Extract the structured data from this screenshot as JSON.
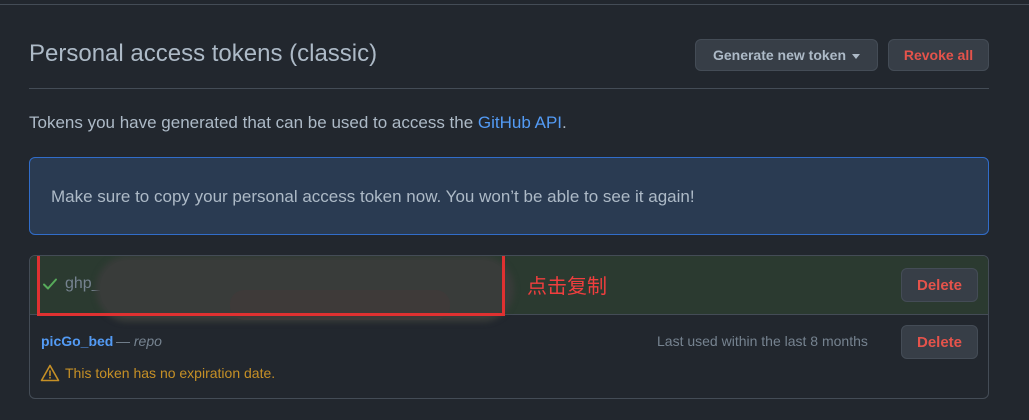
{
  "header": {
    "title": "Personal access tokens (classic)",
    "generate_label": "Generate new token",
    "revoke_label": "Revoke all"
  },
  "description": {
    "text": "Tokens you have generated that can be used to access the ",
    "link": "GitHub API",
    "suffix": "."
  },
  "flash": {
    "message": "Make sure to copy your personal access token now. You won’t be able to see it again!"
  },
  "new_token": {
    "prefix": "ghp_",
    "annotation": "点击复制",
    "delete_label": "Delete"
  },
  "token": {
    "name": "picGo_bed",
    "separator": " — ",
    "scope": "repo",
    "last_used": "Last used within the last 8 months",
    "delete_label": "Delete",
    "warning": "This token has no expiration date."
  },
  "icons": {
    "check": "check-icon",
    "caret": "caret-down-icon",
    "warning": "alert-triangle-icon"
  },
  "colors": {
    "background": "#22272e",
    "link": "#539bf5",
    "danger": "#e5534b",
    "success": "#57ab5a",
    "warning": "#c69026",
    "annotation": "#f03e3e"
  }
}
